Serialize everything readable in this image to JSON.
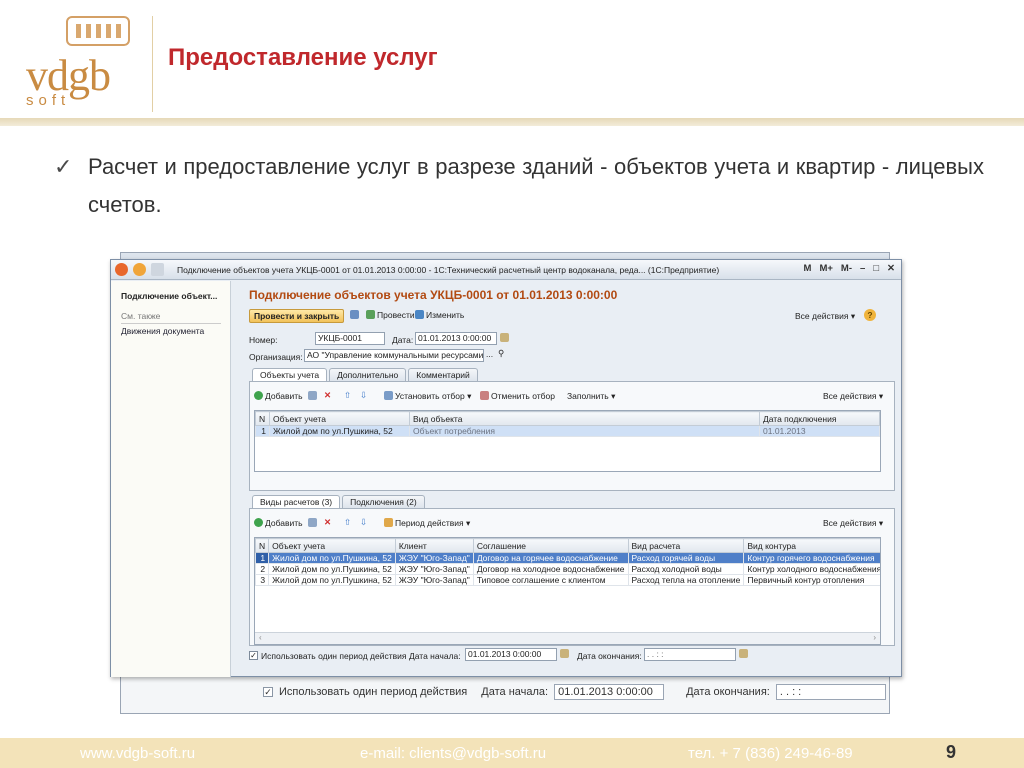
{
  "slide": {
    "logo": {
      "main": "vdgb",
      "sub": "soft"
    },
    "title": "Предоставление услуг",
    "bullet": "Расчет и предоставление услуг в разрезе зданий - объектов учета и квартир - лицевых счетов.",
    "page_number": "9",
    "footer": {
      "site": "www.vdgb-soft.ru",
      "email": "e-mail: clients@vdgb-soft.ru",
      "phone": "тел. + 7 (836) 249-46-89"
    }
  },
  "window": {
    "title": "Подключение объектов учета УКЦБ-0001 от 01.01.2013 0:00:00 - 1С:Технический расчетный центр водоканала, реда... (1С:Предприятие)",
    "title_controls": [
      "M",
      "M+",
      "M-"
    ],
    "sidebar": {
      "header": "Подключение объект...",
      "see_also": "См. также",
      "link": "Движения документа"
    },
    "doc_title": "Подключение объектов учета УКЦБ-0001 от 01.01.2013 0:00:00",
    "toolbar": {
      "post_close": "Провести и закрыть",
      "post": "Провести",
      "edit": "Изменить",
      "all_actions": "Все действия ▾"
    },
    "fields": {
      "number_label": "Номер:",
      "number_value": "УКЦБ-0001",
      "date_label": "Дата:",
      "date_value": "01.01.2013  0:00:00",
      "org_label": "Организация:",
      "org_value": "АО \"Управление коммунальными ресурсами\""
    },
    "tabs_top": [
      "Объекты учета",
      "Дополнительно",
      "Комментарий"
    ],
    "objects_toolbar": {
      "add": "Добавить",
      "set_filter": "Установить отбор ▾",
      "cancel_filter": "Отменить отбор",
      "fill": "Заполнить ▾",
      "all_actions": "Все действия ▾"
    },
    "objects_table": {
      "columns": [
        "N",
        "Объект учета",
        "Вид объекта",
        "Дата подключения"
      ],
      "rows": [
        [
          "1",
          "Жилой дом по ул.Пушкина, 52",
          "Объект потребления",
          "01.01.2013"
        ]
      ]
    },
    "tabs_bottom": [
      "Виды расчетов (3)",
      "Подключения (2)"
    ],
    "calc_toolbar": {
      "add": "Добавить",
      "period_actions": "Период действия ▾",
      "all_actions": "Все действия ▾"
    },
    "calc_table": {
      "columns": [
        "N",
        "Объект учета",
        "Клиент",
        "Соглашение",
        "Вид расчета",
        "Вид контура"
      ],
      "rows": [
        [
          "1",
          "Жилой дом по ул.Пушкина, 52",
          "ЖЭУ \"Юго-Запад\"",
          "Договор на горячее водоснабжение",
          "Расход горячей воды",
          "Контур горячего водоснабжения"
        ],
        [
          "2",
          "Жилой дом по ул.Пушкина, 52",
          "ЖЭУ \"Юго-Запад\"",
          "Договор на холодное водоснабжение",
          "Расход холодной воды",
          "Контур холодного водоснабжения"
        ],
        [
          "3",
          "Жилой дом по ул.Пушкина, 52",
          "ЖЭУ \"Юго-Запад\"",
          "Типовое соглашение с клиентом",
          "Расход тепла на отопление",
          "Первичный контур отопления"
        ]
      ]
    },
    "period": {
      "checkbox_label": "Использовать один период действия",
      "start_label": "Дата начала:",
      "start_value": "01.01.2013  0:00:00",
      "end_label": "Дата окончания:",
      "end_value": " .  .     :  :"
    }
  },
  "colors": {
    "title_red": "#c0282c",
    "brand_gold": "#c98b42",
    "doc_title_orange": "#b24a12",
    "selection_blue": "#4f7fc8"
  }
}
